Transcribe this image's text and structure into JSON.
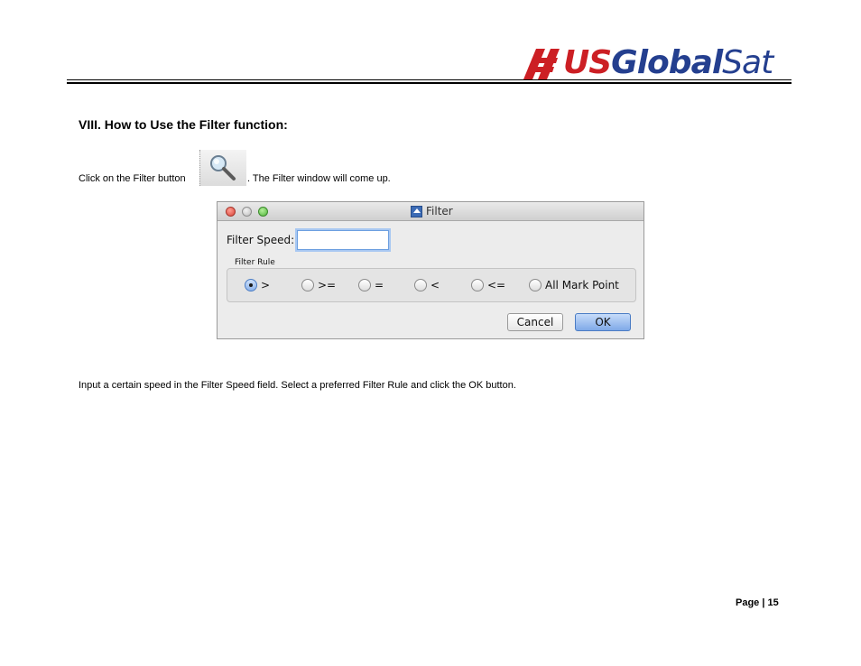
{
  "header": {
    "logo": {
      "part_us": "US",
      "part_global": "Global",
      "part_sat": "Sat",
      "colors": {
        "red": "#cc1f24",
        "blue": "#243f8f"
      }
    }
  },
  "section": {
    "heading": "VIII. How to Use the Filter function:",
    "intro_before": "Click on the Filter button",
    "intro_icon": "magnifier-icon",
    "intro_after": ". The Filter window will come up.",
    "instruction": "Input a certain speed in the Filter Speed field. Select a preferred Filter Rule and click the OK button."
  },
  "dialog": {
    "title": "Filter",
    "speed_label": "Filter Speed:",
    "speed_value": "",
    "rule_label": "Filter Rule",
    "options": [
      ">",
      ">=",
      "=",
      "<",
      "<=",
      "All Mark Point"
    ],
    "selected_option": ">",
    "cancel_label": "Cancel",
    "ok_label": "OK"
  },
  "footer": {
    "page_label": "Page | 15"
  }
}
